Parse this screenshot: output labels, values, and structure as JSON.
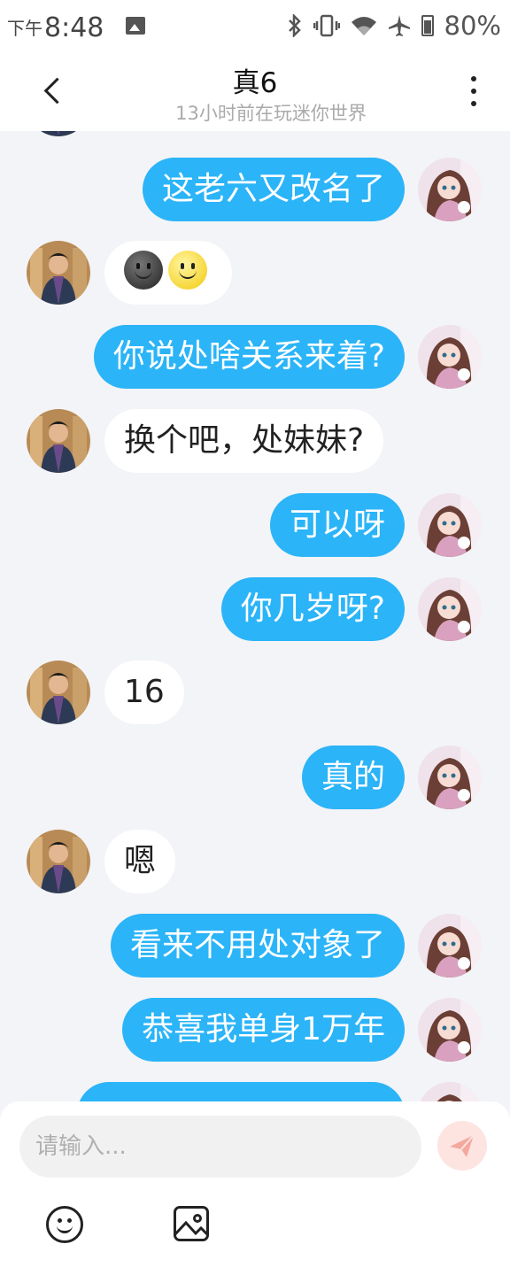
{
  "status_bar": {
    "ampm": "下午",
    "time": "8:48",
    "battery": "80%"
  },
  "header": {
    "title": "真6",
    "subtitle": "13小时前在玩迷你世界"
  },
  "messages": [
    {
      "from": "me",
      "text": "这老六又改名了"
    },
    {
      "from": "them",
      "text": "",
      "emojis": [
        "dark-smiling-face-emoji",
        "smiling-face-emoji"
      ]
    },
    {
      "from": "me",
      "text": "你说处啥关系来着?"
    },
    {
      "from": "them",
      "text": "换个吧，处妹妹?"
    },
    {
      "from": "me",
      "text": "可以呀"
    },
    {
      "from": "me",
      "text": "你几岁呀?"
    },
    {
      "from": "them",
      "text": "16"
    },
    {
      "from": "me",
      "text": "真的"
    },
    {
      "from": "them",
      "text": "嗯"
    },
    {
      "from": "me",
      "text": "看来不用处对象了"
    },
    {
      "from": "me",
      "text": "恭喜我单身1万年"
    }
  ],
  "input": {
    "placeholder": "请输入..."
  },
  "colors": {
    "my_bubble": "#2bb4f8",
    "their_bubble": "#ffffff",
    "background": "#f3f4f7"
  }
}
